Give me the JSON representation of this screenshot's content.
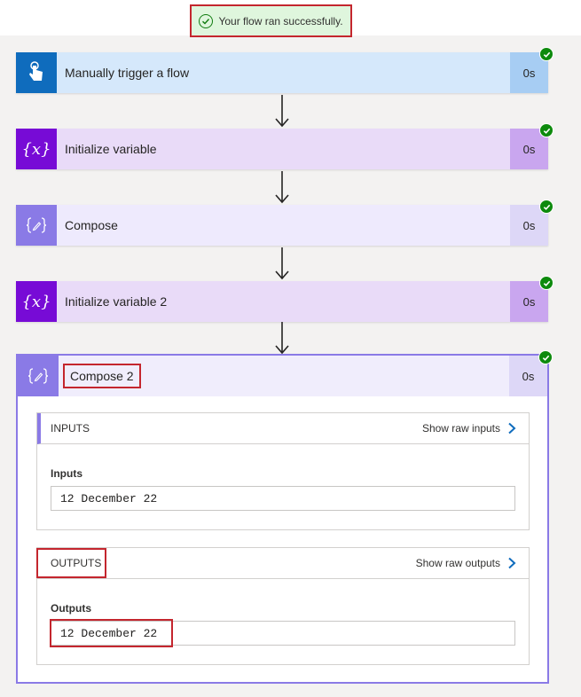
{
  "toast": {
    "message": "Your flow ran successfully."
  },
  "steps": [
    {
      "title": "Manually trigger a flow",
      "duration": "0s",
      "icon": "hand-touch-icon",
      "color": "#0f6cbd"
    },
    {
      "title": "Initialize variable",
      "duration": "0s",
      "icon": "variable-icon",
      "glyph": "{x}",
      "color": "#770bd6"
    },
    {
      "title": "Compose",
      "duration": "0s",
      "icon": "compose-icon",
      "color": "#8a7ae6"
    },
    {
      "title": "Initialize variable 2",
      "duration": "0s",
      "icon": "variable-icon",
      "glyph": "{x}",
      "color": "#770bd6"
    }
  ],
  "expanded": {
    "title": "Compose 2",
    "duration": "0s",
    "icon": "compose-icon",
    "inputs": {
      "header": "INPUTS",
      "raw_link": "Show raw inputs",
      "field_label": "Inputs",
      "value": "12 December 22"
    },
    "outputs": {
      "header": "OUTPUTS",
      "raw_link": "Show raw outputs",
      "field_label": "Outputs",
      "value": "12 December 22"
    }
  },
  "colors": {
    "success": "#0d8a0d",
    "highlight": "#c4262e",
    "trigger_bg": "#d5e8fb",
    "variable_bg": "#e9dbf8",
    "compose_bg": "#eeeafd"
  }
}
